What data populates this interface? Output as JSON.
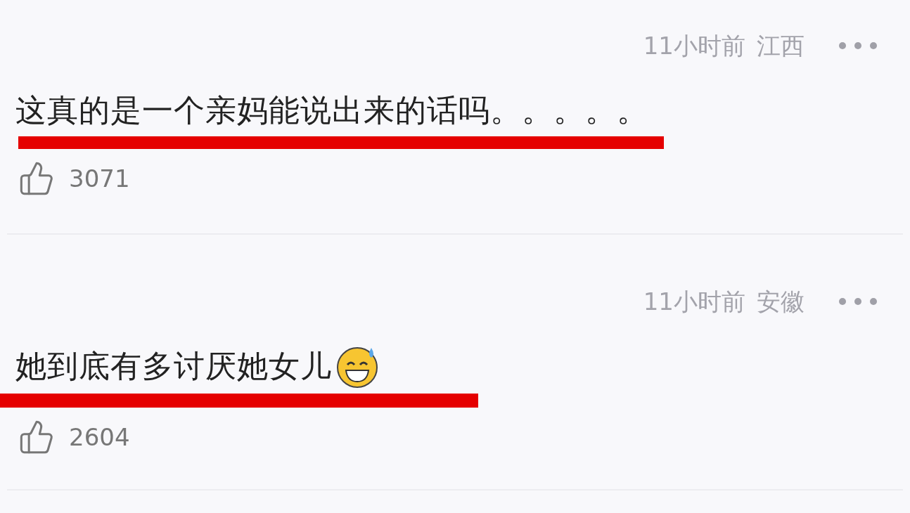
{
  "comments": [
    {
      "time": "11小时前",
      "location": "江西",
      "text": "这真的是一个亲妈能说出来的话吗。。。。。",
      "emoji": false,
      "underlined": true,
      "likes": "3071"
    },
    {
      "time": "11小时前",
      "location": "安徽",
      "text": "她到底有多讨厌她女儿",
      "emoji": true,
      "underlined": true,
      "likes": "2604"
    }
  ]
}
